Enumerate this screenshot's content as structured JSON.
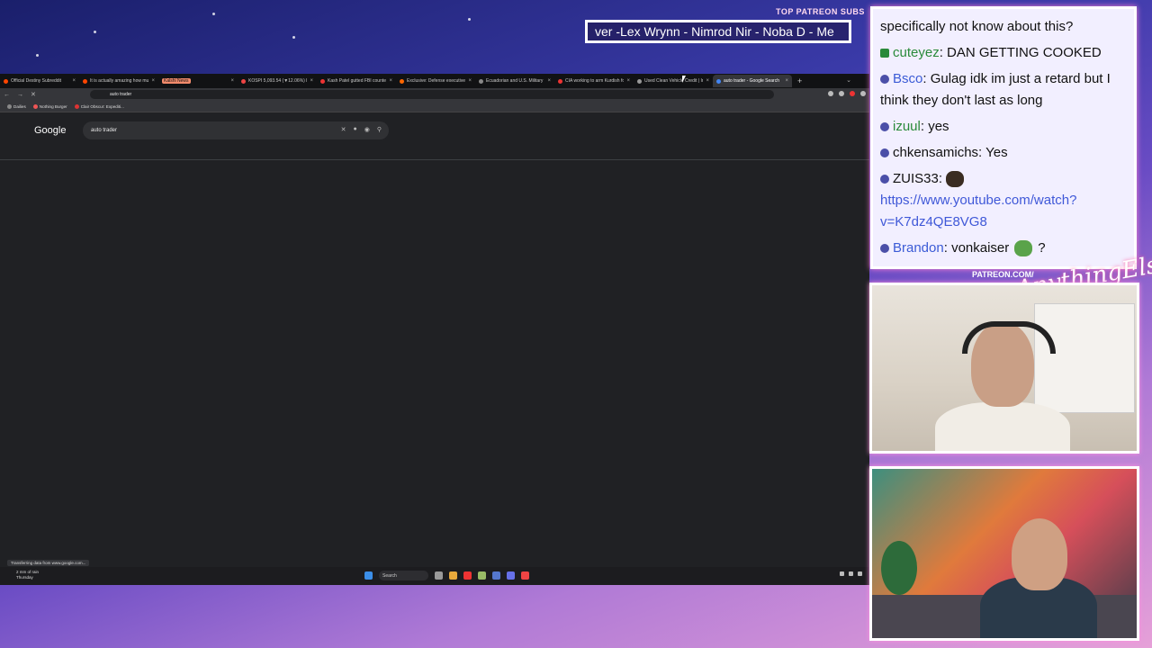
{
  "ticker": {
    "title": "TOP PATREON SUBS",
    "text": "ver -Lex Wrynn - Nimrod Nir - Noba D - Me"
  },
  "browser": {
    "tabs": [
      {
        "label": "Official Destiny Subreddit",
        "color": "#ff4500"
      },
      {
        "label": "It is actually amazing how muc",
        "color": "#ff4500"
      },
      {
        "label": "Kalshi News",
        "color": "#f28b6c",
        "badge": true
      },
      {
        "label": "KOSPI 5,093.54 (▼12.06%) KOS",
        "color": "#e44"
      },
      {
        "label": "Kash Patel gutted FBI counterin",
        "color": "#e33"
      },
      {
        "label": "Exclusive: Defense executives p",
        "color": "#f60"
      },
      {
        "label": "Ecuadorian and U.S. Military Fo",
        "color": "#888"
      },
      {
        "label": "CIA working to arm Kurdish fo",
        "color": "#e33"
      },
      {
        "label": "Used Clean Vehicle Credit | Inte",
        "color": "#999"
      },
      {
        "label": "auto trader - Google Search",
        "color": "#4285f4",
        "active": true
      }
    ],
    "new_tab": "+",
    "address": "auto trader",
    "bookmarks": [
      {
        "label": "Dailies",
        "color": "#888"
      },
      {
        "label": "Nothing Burger",
        "color": "#e55"
      },
      {
        "label": "Clair Obscur: Expediti...",
        "color": "#d33"
      }
    ],
    "google_logo": "Google",
    "search_query": "auto trader",
    "status": "Transferring data from www.google.com...",
    "weather": {
      "line1": "2 mm of rain",
      "line2": "Thursday"
    },
    "taskbar_search": "Search"
  },
  "chat": {
    "messages": [
      {
        "user": "",
        "text": "specifically not know about this?"
      },
      {
        "user": "cuteyez",
        "text": "DAN GETTING COOKED",
        "user_color": "#2a8a3a"
      },
      {
        "user": "Bsco",
        "text": "Gulag idk im just a retard but I think they don't last as long",
        "user_color": "#3b5bd6"
      },
      {
        "user": "izuul",
        "text": "yes",
        "user_color": "#2a8a3a"
      },
      {
        "user": "chkensamichs",
        "text": "Yes",
        "user_color": "#111"
      },
      {
        "user": "ZUIS33",
        "text": "",
        "link": "https://www.youtube.com/watch?v=K7dz4QE8VG8",
        "user_color": "#111"
      },
      {
        "user": "Brandon",
        "text": "vonkaiser",
        "suffix": "?",
        "user_color": "#3b5bd6"
      }
    ]
  },
  "overlay": {
    "patreon": "PATREON.COM/",
    "patreon_script": "AnythingElse"
  }
}
